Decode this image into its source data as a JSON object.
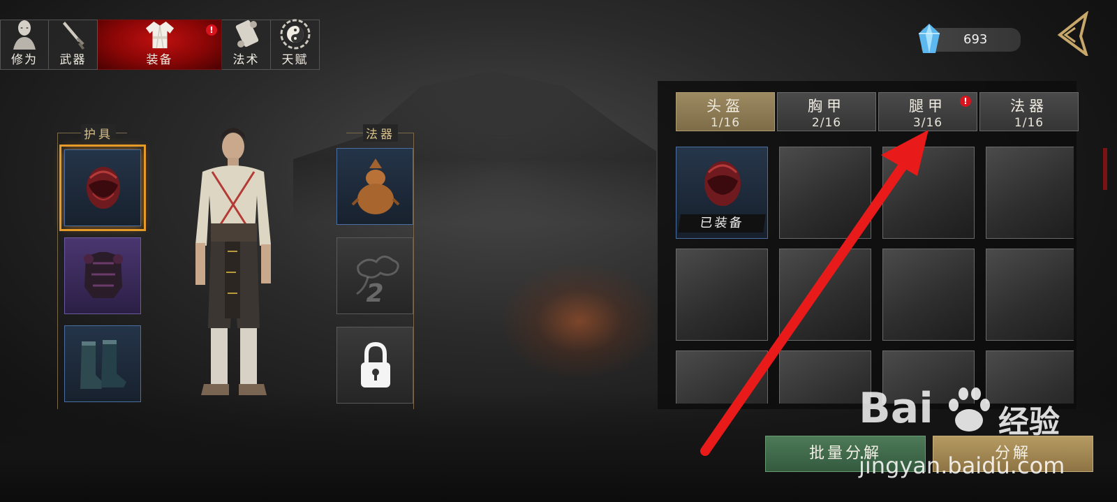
{
  "nav": {
    "tabs": [
      {
        "label": "修为",
        "icon": "meditation-icon"
      },
      {
        "label": "武器",
        "icon": "sword-icon"
      },
      {
        "label": "装备",
        "icon": "robe-icon",
        "active": true,
        "alert": "!"
      },
      {
        "label": "法术",
        "icon": "scroll-icon"
      },
      {
        "label": "天赋",
        "icon": "yinyang-icon"
      }
    ]
  },
  "currency": {
    "icon": "spirit-crystal-icon",
    "value": "693"
  },
  "back_button": {
    "icon": "back-arrow-icon"
  },
  "armor_section": {
    "title": "护具",
    "slots": [
      {
        "item": "helmet-icon",
        "rarity": "blue",
        "selected": true
      },
      {
        "item": "chest-armor-icon",
        "rarity": "purple"
      },
      {
        "item": "boots-icon",
        "rarity": "blue"
      }
    ]
  },
  "artifact_section": {
    "title": "法器",
    "slots": [
      {
        "item": "gourd-icon",
        "rarity": "blue"
      },
      {
        "item": "cloud-scroll-icon",
        "rarity": "grey",
        "number": "2"
      },
      {
        "item": "lock-icon",
        "rarity": "grey",
        "locked": true
      }
    ]
  },
  "categories": [
    {
      "name": "头盔",
      "count": "1/16",
      "active": true
    },
    {
      "name": "胸甲",
      "count": "2/16"
    },
    {
      "name": "腿甲",
      "count": "3/16",
      "alert": "!"
    },
    {
      "name": "法器",
      "count": "1/16"
    }
  ],
  "inventory": {
    "equipped_label": "已装备"
  },
  "buttons": {
    "batch_dismantle": "批量分解",
    "dismantle": "分解"
  },
  "watermark": {
    "logo": "Bai",
    "text": "经验",
    "url": "jingyan.baidu.com"
  },
  "colors": {
    "active_tab": "#a00808",
    "selected_slot": "#e69a28",
    "annotation_arrow": "#e81a1a",
    "batch_button": "#3f6a4a",
    "dismantle_button": "#a88c58"
  }
}
